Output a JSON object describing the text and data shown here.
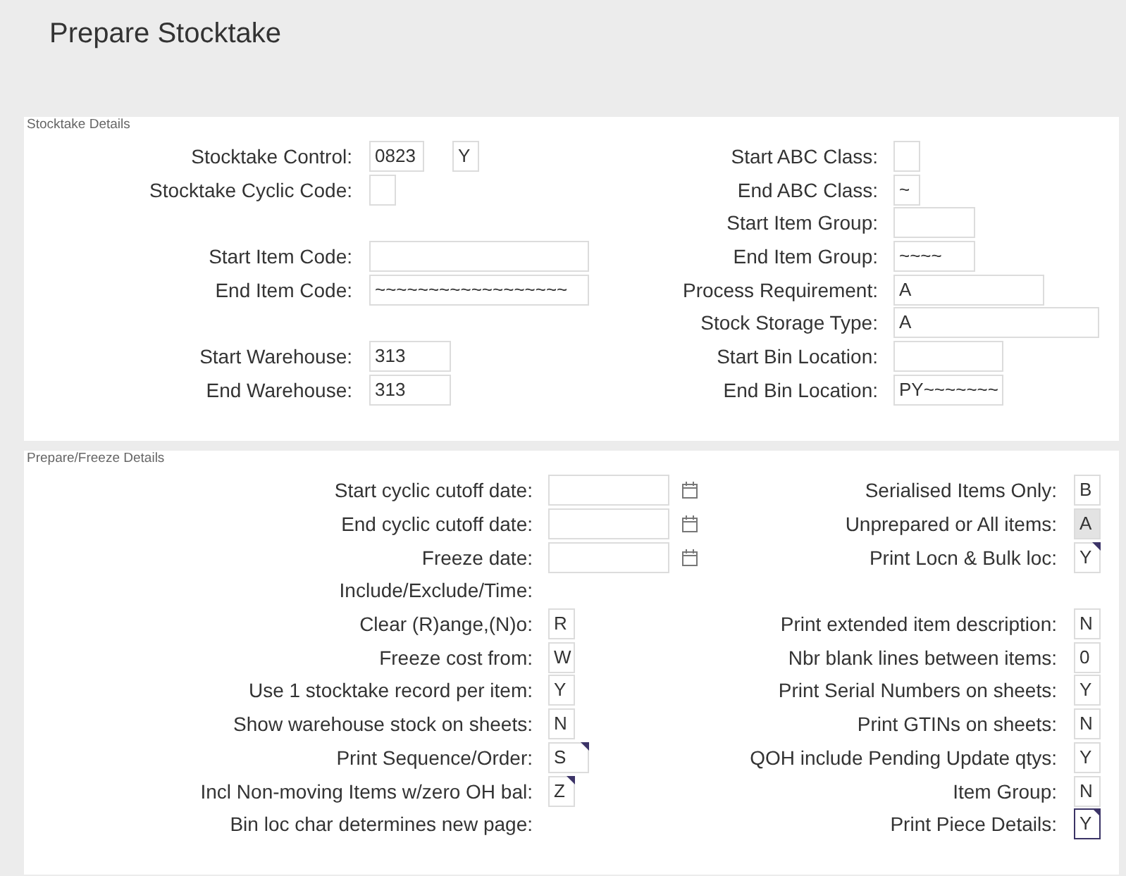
{
  "title": "Prepare Stocktake",
  "sections": [
    {
      "label": "Stocktake Details",
      "columns": [
        {
          "groups": [
            [
              {
                "kind": "input",
                "label": "Stocktake Control:",
                "fields": [
                  {
                    "value": "0823",
                    "readonly": false,
                    "focused": false,
                    "marked": false
                  },
                  {
                    "value": "Y",
                    "readonly": false,
                    "focused": false,
                    "marked": false
                  }
                ]
              },
              {
                "kind": "input",
                "label": "Stocktake Cyclic Code:",
                "fields": [
                  {
                    "readonly": false,
                    "focused": false,
                    "marked": false
                  }
                ]
              }
            ],
            [
              {
                "kind": "input",
                "label": "Start Item Code:",
                "fields": [
                  {
                    "readonly": false,
                    "focused": false,
                    "marked": false
                  }
                ]
              },
              {
                "kind": "input",
                "label": "End Item Code:",
                "fields": [
                  {
                    "value": "~~~~~~~~~~~~~~~~~~",
                    "readonly": false,
                    "focused": false,
                    "marked": false
                  }
                ]
              }
            ],
            [
              {
                "kind": "input",
                "label": "Start Warehouse:",
                "fields": [
                  {
                    "value": "313",
                    "readonly": false,
                    "focused": false,
                    "marked": false
                  }
                ]
              },
              {
                "kind": "input",
                "label": "End Warehouse:",
                "fields": [
                  {
                    "value": "313",
                    "readonly": false,
                    "focused": false,
                    "marked": false
                  }
                ]
              }
            ]
          ]
        },
        {
          "groups": [
            [
              {
                "kind": "input",
                "label": "Start ABC Class:",
                "fields": [
                  {
                    "readonly": false,
                    "focused": false,
                    "marked": false
                  }
                ]
              },
              {
                "kind": "input",
                "label": "End ABC Class:",
                "fields": [
                  {
                    "value": "~",
                    "readonly": false,
                    "focused": false,
                    "marked": false
                  }
                ]
              },
              {
                "kind": "input",
                "label": "Start Item Group:",
                "fields": [
                  {
                    "readonly": false,
                    "focused": false,
                    "marked": false
                  }
                ]
              },
              {
                "kind": "input",
                "label": "End Item Group:",
                "fields": [
                  {
                    "value": "~~~~",
                    "readonly": false,
                    "focused": false,
                    "marked": false
                  }
                ]
              },
              {
                "kind": "input",
                "label": "Process Requirement:",
                "fields": [
                  {
                    "value": "A",
                    "readonly": false,
                    "focused": false,
                    "marked": false
                  }
                ]
              },
              {
                "kind": "input",
                "label": "Stock Storage Type:",
                "fields": [
                  {
                    "value": "A",
                    "readonly": false,
                    "focused": false,
                    "marked": false
                  }
                ]
              },
              {
                "kind": "input",
                "label": "Start Bin Location:",
                "fields": [
                  {
                    "readonly": false,
                    "focused": false,
                    "marked": false
                  }
                ]
              },
              {
                "kind": "input",
                "label": "End Bin Location:",
                "fields": [
                  {
                    "value": "PY~~~~~~~",
                    "readonly": false,
                    "focused": false,
                    "marked": false
                  }
                ]
              }
            ]
          ]
        }
      ]
    },
    {
      "label": "Prepare/Freeze Details",
      "columns": [
        {
          "groups": [
            [
              {
                "kind": "date",
                "label": "Start cyclic cutoff date:",
                "fields": [
                  {
                    "readonly": false,
                    "focused": false,
                    "marked": false
                  }
                ]
              },
              {
                "kind": "date",
                "label": "End cyclic cutoff date:",
                "fields": [
                  {
                    "readonly": false,
                    "focused": false,
                    "marked": false
                  }
                ]
              },
              {
                "kind": "date",
                "label": "Freeze date:",
                "fields": [
                  {
                    "readonly": false,
                    "focused": false,
                    "marked": false
                  }
                ]
              },
              {
                "kind": "label",
                "label": "Include/Exclude/Time:"
              },
              {
                "kind": "input",
                "label": "Clear (R)ange,(N)o:",
                "fields": [
                  {
                    "value": "R",
                    "readonly": false,
                    "focused": false,
                    "marked": false
                  }
                ]
              },
              {
                "kind": "input",
                "label": "Freeze cost from:",
                "fields": [
                  {
                    "value": "W",
                    "readonly": false,
                    "focused": false,
                    "marked": false
                  }
                ]
              },
              {
                "kind": "input",
                "label": "Use 1 stocktake record per item:",
                "fields": [
                  {
                    "value": "Y",
                    "readonly": false,
                    "focused": false,
                    "marked": false
                  }
                ]
              },
              {
                "kind": "input",
                "label": "Show warehouse stock on sheets:",
                "fields": [
                  {
                    "value": "N",
                    "readonly": false,
                    "focused": false,
                    "marked": false
                  }
                ]
              },
              {
                "kind": "input",
                "label": "Print Sequence/Order:",
                "fields": [
                  {
                    "value": "S",
                    "readonly": false,
                    "focused": false,
                    "marked": true
                  }
                ]
              },
              {
                "kind": "input",
                "label": "Incl Non-moving Items w/zero OH bal:",
                "fields": [
                  {
                    "value": "Z",
                    "readonly": false,
                    "focused": false,
                    "marked": true
                  }
                ]
              },
              {
                "kind": "label",
                "label": "Bin loc char determines new page:"
              }
            ]
          ]
        },
        {
          "groups": [
            [
              {
                "kind": "input",
                "label": "Serialised Items Only:",
                "fields": [
                  {
                    "value": "B",
                    "readonly": false,
                    "focused": false,
                    "marked": false
                  }
                ]
              },
              {
                "kind": "input",
                "label": "Unprepared or All items:",
                "fields": [
                  {
                    "value": "A",
                    "readonly": true,
                    "focused": false,
                    "marked": false
                  }
                ]
              },
              {
                "kind": "input",
                "label": "Print Locn & Bulk loc:",
                "fields": [
                  {
                    "value": "Y",
                    "readonly": false,
                    "focused": false,
                    "marked": true
                  }
                ]
              }
            ],
            [
              {
                "kind": "input",
                "label": "Print extended item description:",
                "fields": [
                  {
                    "value": "N",
                    "readonly": false,
                    "focused": false,
                    "marked": false
                  }
                ]
              },
              {
                "kind": "input",
                "label": "Nbr blank lines between items:",
                "fields": [
                  {
                    "value": "0",
                    "readonly": false,
                    "focused": false,
                    "marked": false
                  }
                ]
              },
              {
                "kind": "input",
                "label": "Print Serial Numbers on sheets:",
                "fields": [
                  {
                    "value": "Y",
                    "readonly": false,
                    "focused": false,
                    "marked": false
                  }
                ]
              },
              {
                "kind": "input",
                "label": "Print GTINs on sheets:",
                "fields": [
                  {
                    "value": "N",
                    "readonly": false,
                    "focused": false,
                    "marked": false
                  }
                ]
              },
              {
                "kind": "input",
                "label": "QOH include Pending Update qtys:",
                "fields": [
                  {
                    "value": "Y",
                    "readonly": false,
                    "focused": false,
                    "marked": false
                  }
                ]
              },
              {
                "kind": "input",
                "label": "Item Group:",
                "fields": [
                  {
                    "value": "N",
                    "readonly": false,
                    "focused": false,
                    "marked": false
                  }
                ]
              },
              {
                "kind": "input",
                "label": "Print Piece Details:",
                "fields": [
                  {
                    "value": "Y",
                    "readonly": false,
                    "focused": true,
                    "marked": true
                  }
                ]
              }
            ]
          ]
        }
      ]
    }
  ]
}
